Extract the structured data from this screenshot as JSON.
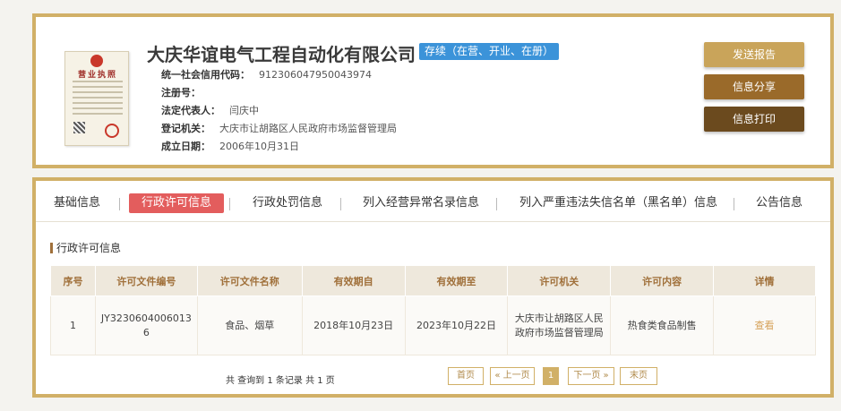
{
  "company": {
    "name": "大庆华谊电气工程自动化有限公司",
    "status": "存续（在营、开业、在册）",
    "license_image": {
      "title": "营业执照"
    },
    "fields": [
      {
        "label": "统一社会信用代码：",
        "value": "912306047950043974"
      },
      {
        "label": "注册号：",
        "value": ""
      },
      {
        "label": "法定代表人：",
        "value": "闫庆中"
      },
      {
        "label": "登记机关：",
        "value": "大庆市让胡路区人民政府市场监督管理局"
      },
      {
        "label": "成立日期：",
        "value": "2006年10月31日"
      }
    ],
    "actions": [
      {
        "label": "发送报告",
        "color": "#c9a45a"
      },
      {
        "label": "信息分享",
        "color": "#9a6a2a"
      },
      {
        "label": "信息打印",
        "color": "#6b4a1e"
      }
    ]
  },
  "tabs": [
    {
      "label": "基础信息",
      "active": false
    },
    {
      "label": "行政许可信息",
      "active": true
    },
    {
      "label": "行政处罚信息",
      "active": false
    },
    {
      "label": "列入经营异常名录信息",
      "active": false
    },
    {
      "label": "列入严重违法失信名单（黑名单）信息",
      "active": false
    },
    {
      "label": "公告信息",
      "active": false
    }
  ],
  "section": {
    "title": "行政许可信息"
  },
  "table": {
    "headers": [
      "序号",
      "许可文件编号",
      "许可文件名称",
      "有效期自",
      "有效期至",
      "许可机关",
      "许可内容",
      "详情"
    ],
    "rows": [
      {
        "index": "1",
        "doc_no": "JY32306040060136",
        "doc_name": "食品、烟草",
        "valid_from": "2018年10月23日",
        "valid_to": "2023年10月22日",
        "authority": "大庆市让胡路区人民政府市场监督管理局",
        "content": "热食类食品制售",
        "detail": "查看"
      }
    ]
  },
  "pager": {
    "summary": "共 查询到 1 条记录 共 1 页",
    "first": "首页",
    "prev": "« 上一页",
    "current": "1",
    "next": "下一页 »",
    "last": "末页"
  }
}
